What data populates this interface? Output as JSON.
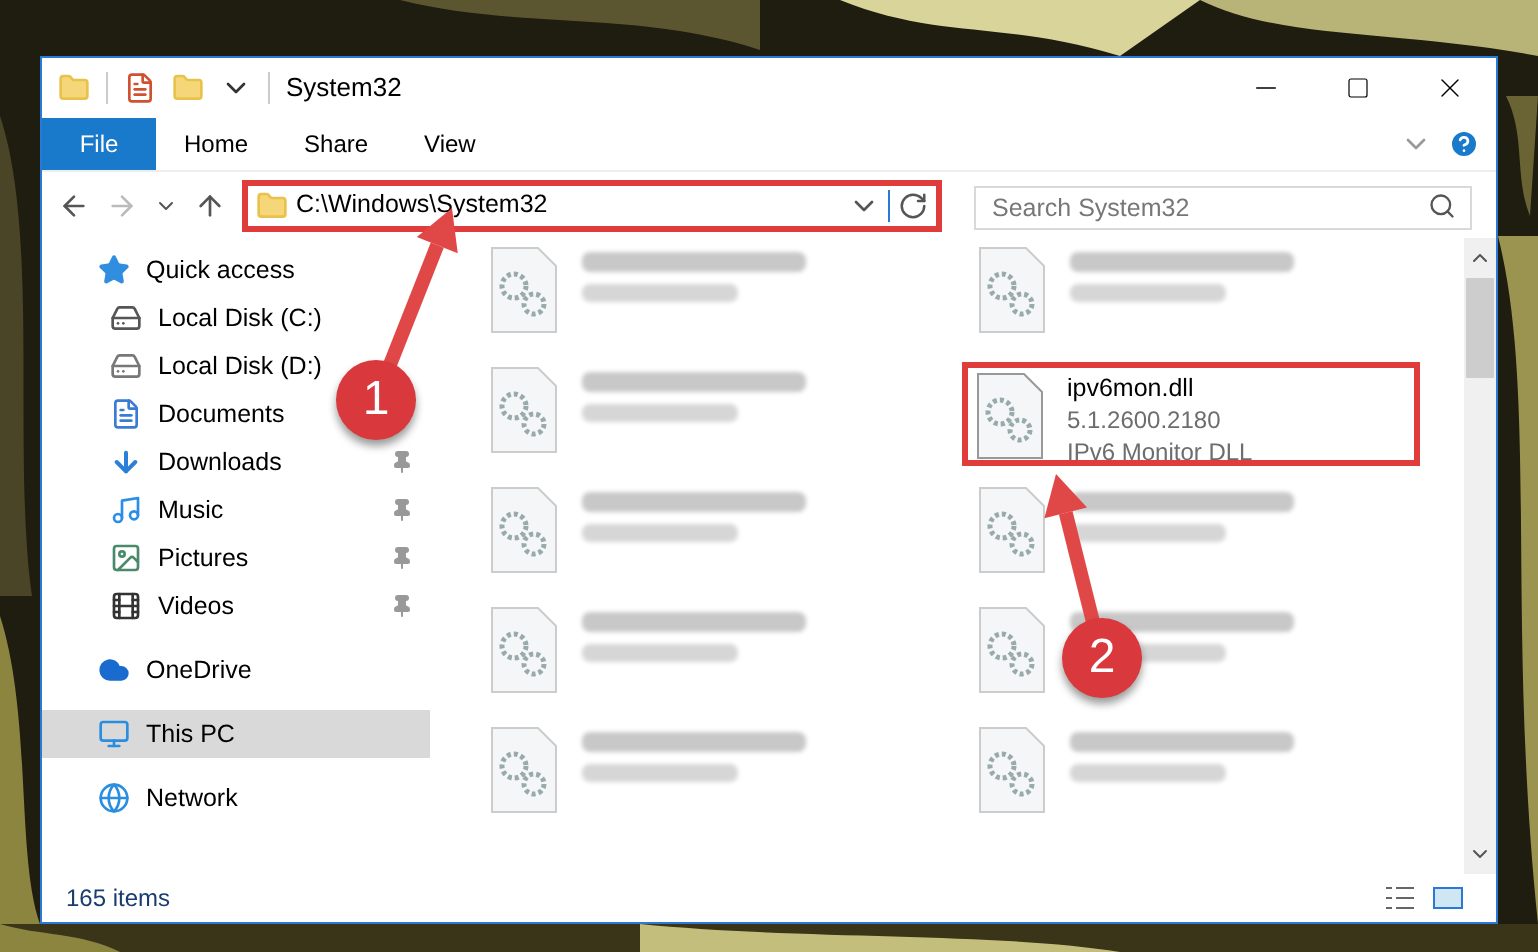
{
  "window": {
    "title": "System32"
  },
  "ribbon": {
    "tabs": [
      {
        "label": "File",
        "kind": "file"
      },
      {
        "label": "Home",
        "kind": "tab"
      },
      {
        "label": "Share",
        "kind": "tab"
      },
      {
        "label": "View",
        "kind": "tab"
      }
    ]
  },
  "address_bar": {
    "path": "C:\\Windows\\System32",
    "highlighted": true
  },
  "search": {
    "placeholder": "Search System32"
  },
  "sidebar": {
    "items": [
      {
        "label": "Quick access",
        "kind": "star",
        "selected": false,
        "children": [
          {
            "label": "Local Disk (C:)",
            "kind": "drive-c",
            "selected": false
          },
          {
            "label": "Local Disk (D:)",
            "kind": "drive",
            "selected": false
          },
          {
            "label": "Documents",
            "kind": "documents",
            "selected": false
          },
          {
            "label": "Downloads",
            "kind": "downloads",
            "selected": false,
            "pinned": true
          },
          {
            "label": "Music",
            "kind": "music",
            "selected": false,
            "pinned": true
          },
          {
            "label": "Pictures",
            "kind": "pictures",
            "selected": false,
            "pinned": true
          },
          {
            "label": "Videos",
            "kind": "videos",
            "selected": false,
            "pinned": true
          }
        ]
      },
      {
        "label": "OneDrive",
        "kind": "cloud",
        "selected": false
      },
      {
        "label": "This PC",
        "kind": "pc",
        "selected": true
      },
      {
        "label": "Network",
        "kind": "network",
        "selected": false
      }
    ]
  },
  "files": [
    {
      "kind": "blurred"
    },
    {
      "kind": "blurred"
    },
    {
      "kind": "blurred"
    },
    {
      "kind": "file",
      "name": "ipv6mon.dll",
      "lines": [
        "5.1.2600.2180",
        "IPv6 Monitor DLL"
      ],
      "highlighted": true
    },
    {
      "kind": "blurred"
    },
    {
      "kind": "blurred"
    },
    {
      "kind": "blurred"
    },
    {
      "kind": "blurred"
    },
    {
      "kind": "blurred"
    },
    {
      "kind": "blurred"
    }
  ],
  "status_bar": {
    "count": "165 items"
  },
  "callouts": [
    {
      "number": "1"
    },
    {
      "number": "2"
    }
  ]
}
